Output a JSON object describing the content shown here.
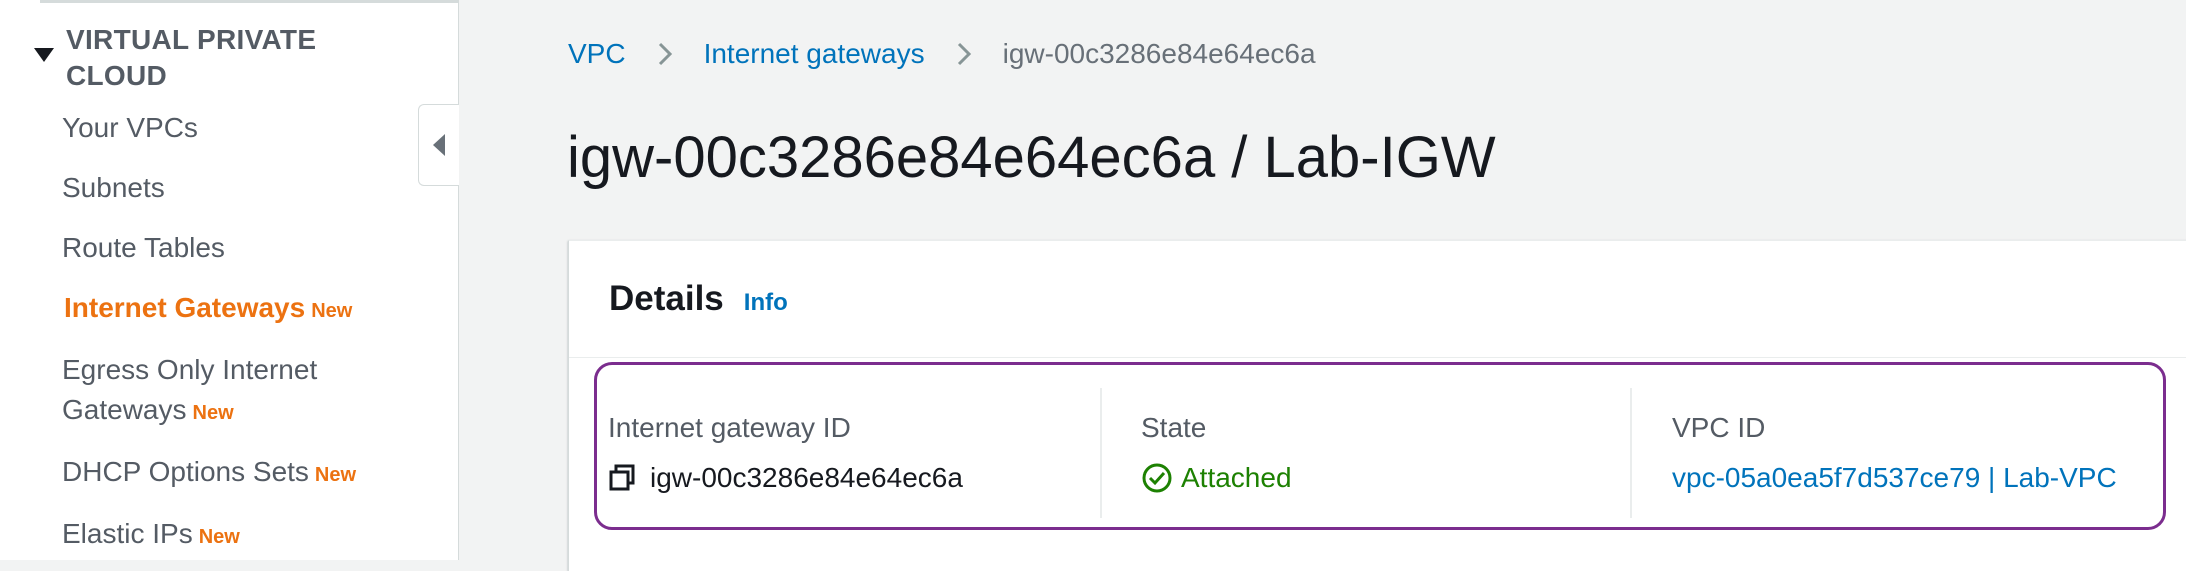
{
  "sidebar": {
    "section_title": "VIRTUAL PRIVATE CLOUD",
    "items": [
      {
        "label": "Your VPCs",
        "badge": ""
      },
      {
        "label": "Subnets",
        "badge": ""
      },
      {
        "label": "Route Tables",
        "badge": ""
      },
      {
        "label": "Internet Gateways",
        "badge": "New",
        "active": true
      },
      {
        "label": "Egress Only Internet Gateways",
        "line1": "Egress Only Internet",
        "line2": "Gateways",
        "badge": "New"
      },
      {
        "label": "DHCP Options Sets",
        "badge": "New"
      },
      {
        "label": "Elastic IPs",
        "badge": "New"
      }
    ]
  },
  "breadcrumb": {
    "items": [
      "VPC",
      "Internet gateways",
      "igw-00c3286e84e64ec6a"
    ]
  },
  "page": {
    "title": "igw-00c3286e84e64ec6a / Lab-IGW"
  },
  "details": {
    "title": "Details",
    "info_label": "Info",
    "fields": [
      {
        "label": "Internet gateway ID",
        "value": "igw-00c3286e84e64ec6a",
        "icon": "copy-icon"
      },
      {
        "label": "State",
        "value": "Attached",
        "icon": "check-circle-icon"
      },
      {
        "label": "VPC ID",
        "value": "vpc-05a0ea5f7d537ce79 | Lab-VPC"
      }
    ]
  },
  "colors": {
    "accent_orange": "#ec7211",
    "link_blue": "#0073bb",
    "success_green": "#1d8102",
    "highlight_purple": "#7b2d8e"
  }
}
